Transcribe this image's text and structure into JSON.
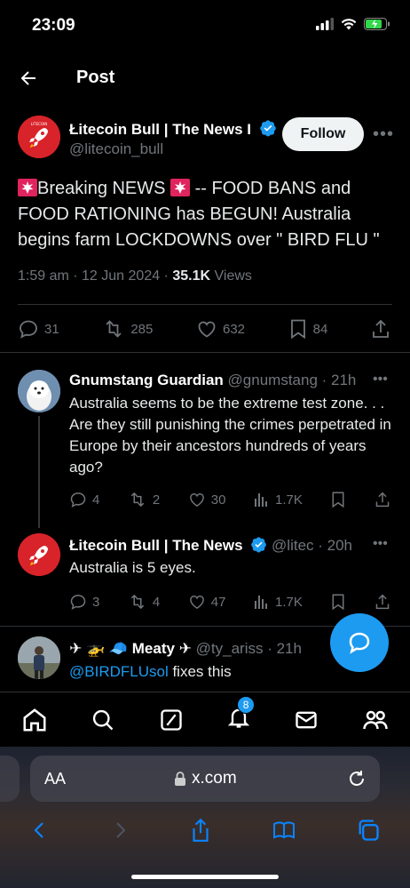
{
  "status_bar": {
    "time": "23:09"
  },
  "header": {
    "title": "Post"
  },
  "main_post": {
    "author_name": "Łitecoin Bull | The News I",
    "author_handle": "@litecoin_bull",
    "follow_label": "Follow",
    "text_part1": "Breaking NEWS",
    "text_part2": "-- FOOD BANS and FOOD RATIONING has BEGUN! Australia begins farm LOCKDOWNS over \" BIRD FLU \"",
    "time": "1:59 am · 12 Jun 2024 ·",
    "views_count": "35.1K",
    "views_label": "Views",
    "replies": "31",
    "reposts": "285",
    "likes": "632",
    "bookmarks": "84"
  },
  "replies": [
    {
      "name": "Gnumstang Guardian",
      "handle": "@gnumstang · 21h",
      "text": "Australia seems to be the extreme test zone. . .  Are they still punishing the crimes perpetrated in Europe by their ancestors hundreds of years ago?",
      "replies": "4",
      "reposts": "2",
      "likes": "30",
      "views": "1.7K"
    },
    {
      "name": "Łitecoin Bull | The News",
      "handle": "@litec · 20h",
      "text": "Australia is 5 eyes.",
      "replies": "3",
      "reposts": "4",
      "likes": "47",
      "views": "1.7K"
    },
    {
      "name_prefix": "✈ 🚁 🧢",
      "name": "Meaty ✈",
      "handle": "@ty_ariss · 21h",
      "mention": "@BIRDFLUsol",
      "text": " fixes this"
    }
  ],
  "tabbar": {
    "notifications_badge": "8"
  },
  "safari": {
    "aa": "AA",
    "url": "x.com"
  },
  "colors": {
    "accent": "#1d9bf0",
    "text": "#e7e9ea",
    "muted": "#71767b",
    "brand_avatar": "#d8232a"
  },
  "icons": [
    "back-arrow-icon",
    "verified-icon",
    "more-icon",
    "reply-icon",
    "repost-icon",
    "like-icon",
    "bookmark-icon",
    "share-icon",
    "views-icon",
    "home-icon",
    "search-icon",
    "grok-icon",
    "bell-icon",
    "mail-icon",
    "people-icon",
    "lock-icon",
    "reload-icon",
    "compose-reply-icon"
  ]
}
